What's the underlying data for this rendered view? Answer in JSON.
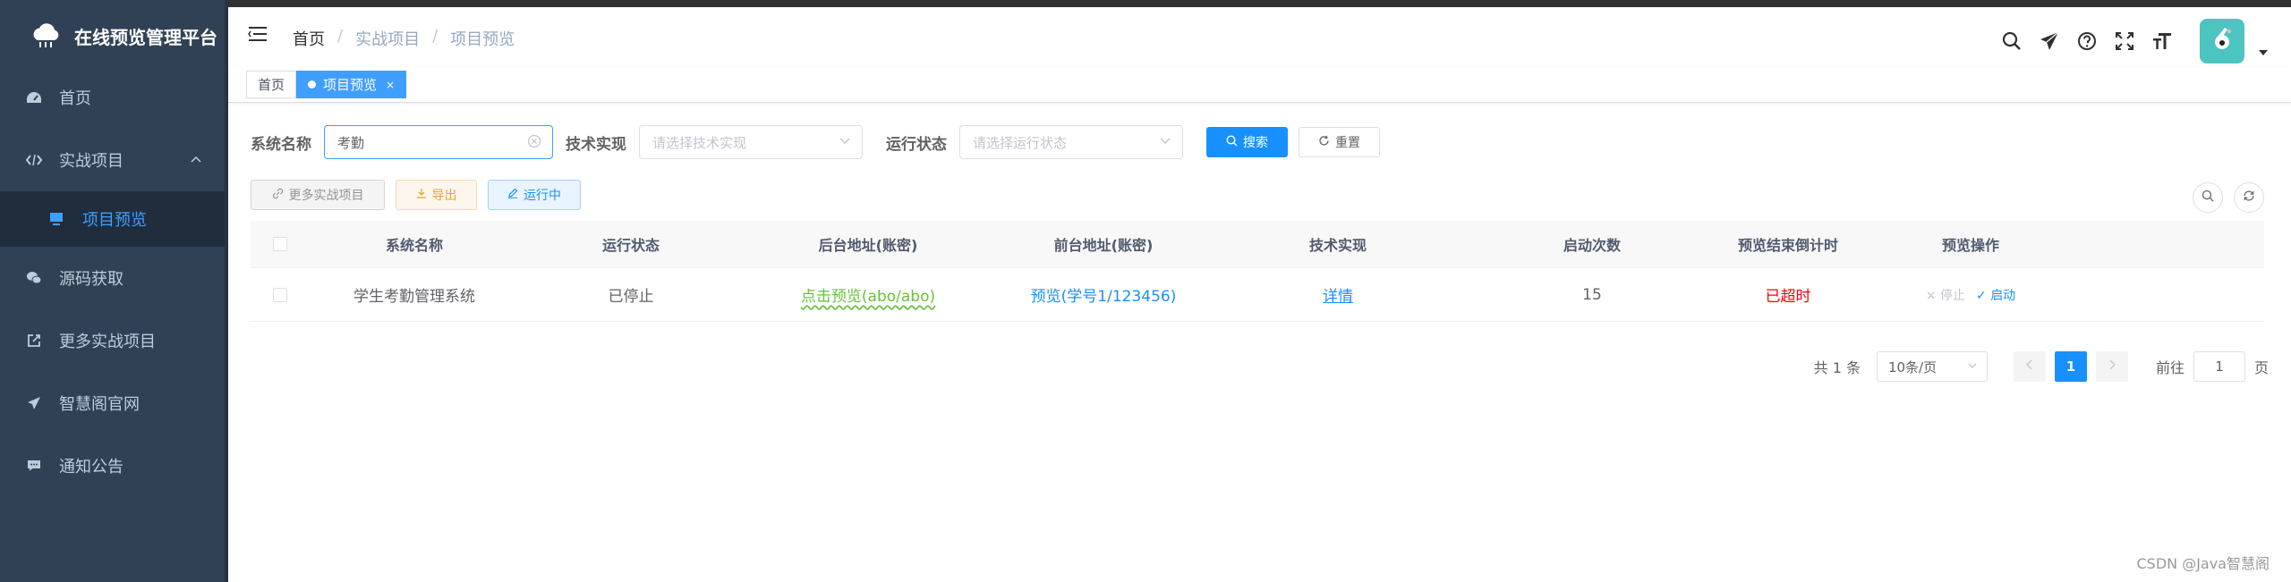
{
  "app": {
    "title": "在线预览管理平台"
  },
  "sidebar": {
    "items": [
      {
        "label": "首页",
        "icon": "dashboard-icon"
      },
      {
        "label": "实战项目",
        "icon": "code-icon",
        "expanded": true,
        "children": [
          {
            "label": "项目预览",
            "icon": "monitor-icon",
            "active": true
          }
        ]
      },
      {
        "label": "源码获取",
        "icon": "wechat-icon"
      },
      {
        "label": "更多实战项目",
        "icon": "external-link-icon"
      },
      {
        "label": "智慧阁官网",
        "icon": "send-icon"
      },
      {
        "label": "通知公告",
        "icon": "message-icon"
      }
    ]
  },
  "navbar": {
    "breadcrumb": [
      "首页",
      "实战项目",
      "项目预览"
    ],
    "separator": "/"
  },
  "tags": [
    {
      "label": "首页",
      "active": false
    },
    {
      "label": "项目预览",
      "active": true,
      "close": "×"
    }
  ],
  "search": {
    "fields": [
      {
        "label": "系统名称",
        "value": "考勤",
        "placeholder": ""
      },
      {
        "label": "技术实现",
        "value": "",
        "placeholder": "请选择技术实现"
      },
      {
        "label": "运行状态",
        "value": "",
        "placeholder": "请选择运行状态"
      }
    ],
    "search_label": "搜索",
    "reset_label": "重置"
  },
  "toolbar": {
    "more_label": "更多实战项目",
    "export_label": "导出",
    "running_label": "运行中"
  },
  "table": {
    "headers": [
      "系统名称",
      "运行状态",
      "后台地址(账密)",
      "前台地址(账密)",
      "技术实现",
      "启动次数",
      "预览结束倒计时",
      "预览操作"
    ],
    "rows": [
      {
        "name": "学生考勤管理系统",
        "status": "已停止",
        "backend": "点击预览(abo/abo)",
        "frontend": "预览(学号1/123456)",
        "tech": "详情",
        "starts": "15",
        "countdown": "已超时",
        "stop_label": "停止",
        "start_label": "启动"
      }
    ]
  },
  "pagination": {
    "total": "共 1 条",
    "page_size": "10条/页",
    "current": "1",
    "goto_prefix": "前往",
    "goto_value": "1",
    "goto_suffix": "页"
  },
  "watermark": "CSDN @Java智慧阁",
  "colors": {
    "sidebar_bg": "#304156",
    "primary": "#1890ff",
    "active_tag": "#409eff",
    "green_link": "#67c23a",
    "timeout_red": "#ff0000"
  }
}
